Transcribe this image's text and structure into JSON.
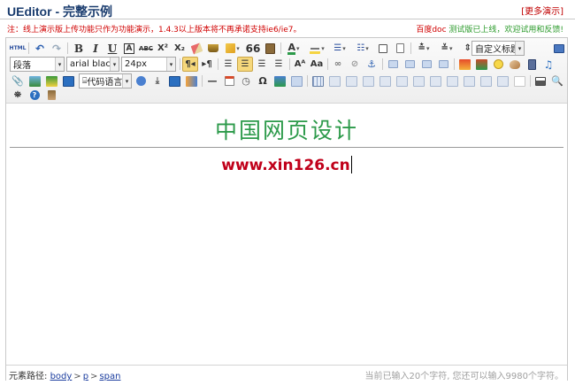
{
  "page": {
    "title": "UEditor - 完整示例",
    "more_demos": "[更多演示]",
    "notice_left": "注：线上演示版上传功能只作为功能演示，1.4.3以上版本将不再承诺支持ie6/ie7。",
    "notice_right_brand": "百度doc",
    "notice_right_text": " 测试版已上线，欢迎试用和反馈!"
  },
  "toolbar": {
    "paragraph_format": "段落",
    "font_family": "arial black",
    "font_size": "24px",
    "custom_title": "自定义标题",
    "code_language": "代码语言",
    "html_label": "HTML",
    "bold": "B",
    "italic": "I",
    "underline": "U",
    "font_border": "A",
    "strikethrough": "ABC",
    "superscript": "X²",
    "subscript": "X₂",
    "blockquote": "66",
    "font_color": "A",
    "hr": "—",
    "special_char": "Ω"
  },
  "content": {
    "heading": "中国网页设计",
    "url_text": "www.xin126.cn",
    "heading_color": "#2c9a4a",
    "url_color": "#c0001a"
  },
  "statusbar": {
    "path_label": "元素路径: ",
    "path": [
      "body",
      "p",
      "span"
    ],
    "char_count": "当前已输入20个字符, 您还可以输入9980个字符。"
  }
}
